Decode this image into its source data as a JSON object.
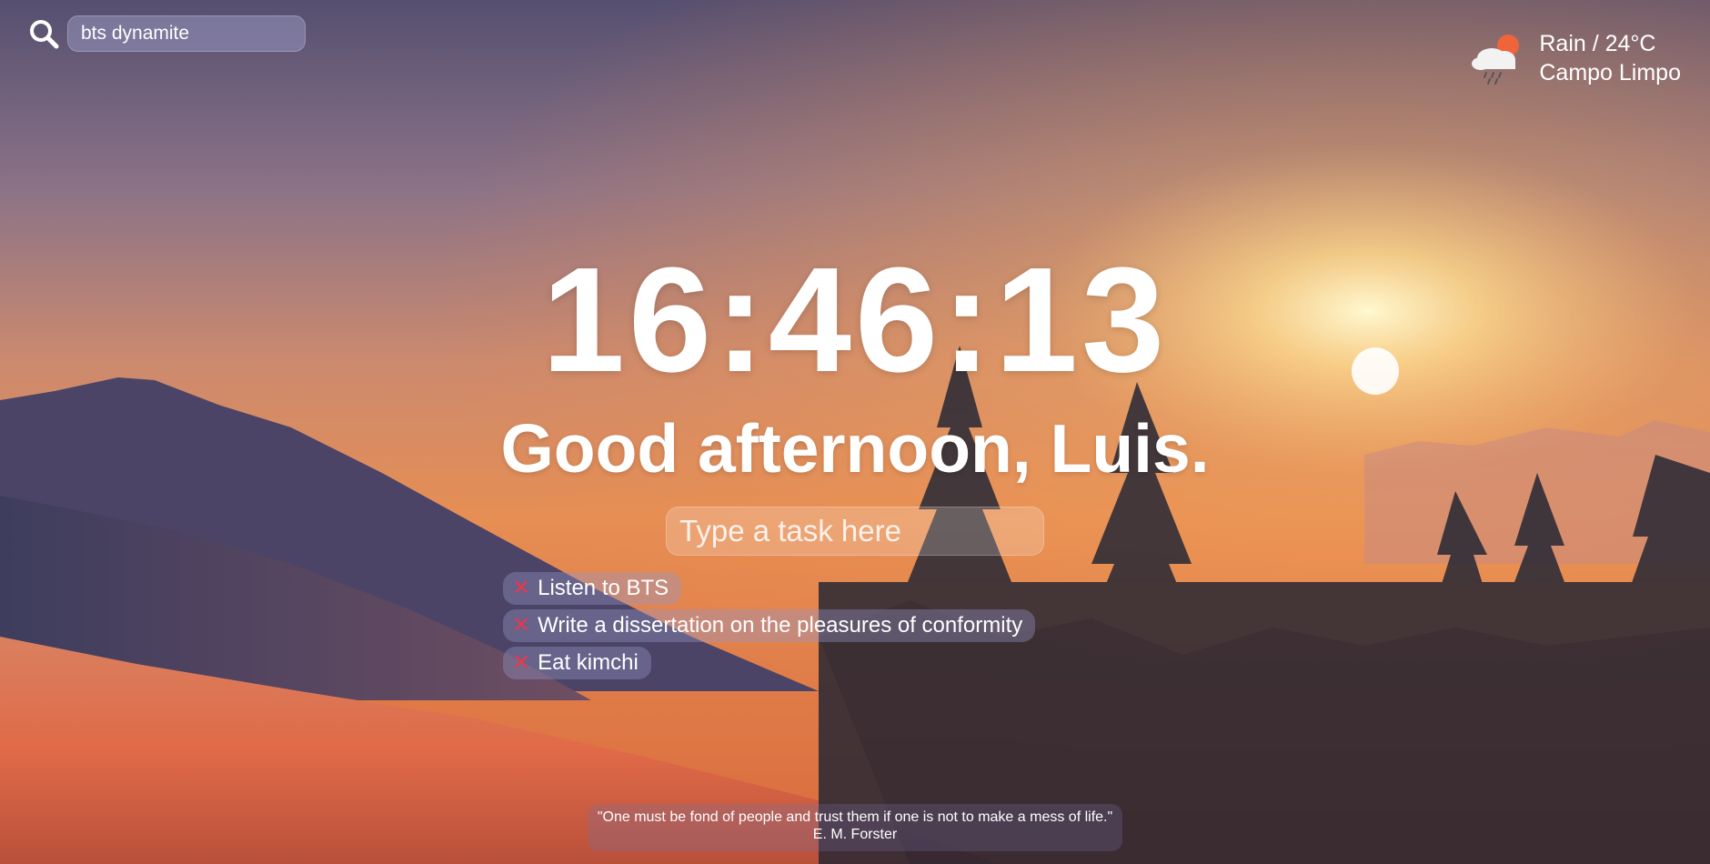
{
  "search": {
    "value": "bts dynamite",
    "icon": "search-icon"
  },
  "weather": {
    "condition": "Rain / 24°C",
    "location": "Campo Limpo",
    "icon": "cloud-rain-sun-icon"
  },
  "clock": {
    "time": "16:46:13"
  },
  "greeting": {
    "text": "Good afternoon, Luis."
  },
  "task_input": {
    "placeholder": "Type a task here"
  },
  "tasks": [
    {
      "label": "Listen to BTS",
      "delete_icon": "✕"
    },
    {
      "label": "Write a dissertation on the pleasures of conformity",
      "delete_icon": "✕"
    },
    {
      "label": "Eat kimchi",
      "delete_icon": "✕"
    }
  ],
  "quote": {
    "text": "\"One must be fond of people and trust them if one is not to make a mess of life.\"",
    "author": "E. M. Forster"
  },
  "colors": {
    "delete": "#e8384d",
    "sky_top": "#5a5475",
    "sun": "#fff3c4",
    "snow": "#d8684a"
  }
}
